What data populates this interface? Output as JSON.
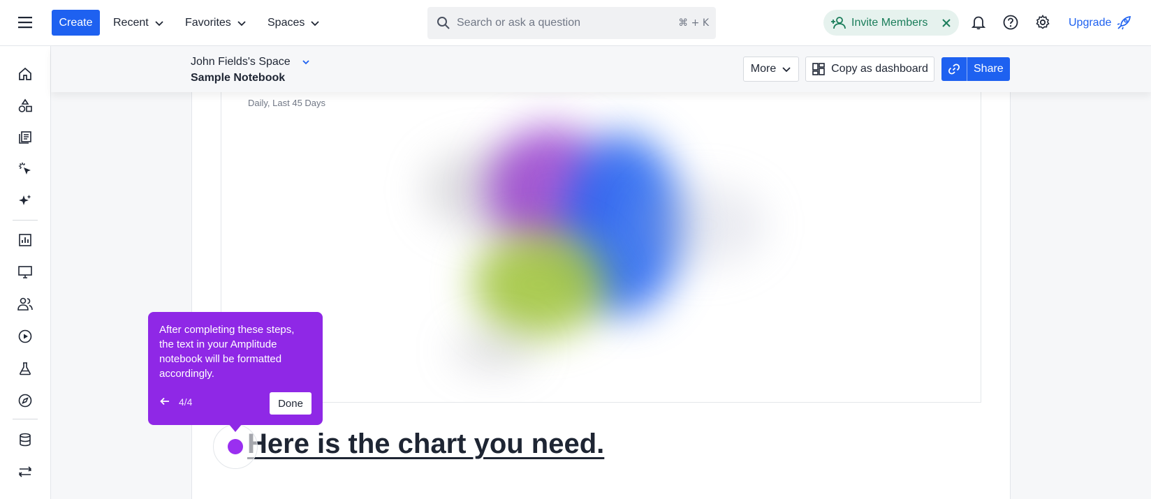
{
  "topbar": {
    "create_label": "Create",
    "nav": [
      {
        "label": "Recent"
      },
      {
        "label": "Favorites"
      },
      {
        "label": "Spaces"
      }
    ],
    "search": {
      "placeholder": "Search or ask a question",
      "shortcut": "⌘ + K"
    },
    "invite_label": "Invite Members",
    "upgrade_label": "Upgrade"
  },
  "sidebar": {
    "items": [
      {
        "icon": "home-icon"
      },
      {
        "icon": "shapes-icon"
      },
      {
        "icon": "content-icon"
      },
      {
        "icon": "click-icon"
      },
      {
        "icon": "sparkle-icon"
      },
      {
        "icon": "chart-icon"
      },
      {
        "icon": "monitor-icon"
      },
      {
        "icon": "users-icon"
      },
      {
        "icon": "replay-icon"
      },
      {
        "icon": "flask-icon"
      },
      {
        "icon": "compass-icon"
      },
      {
        "icon": "database-icon"
      },
      {
        "icon": "pipeline-icon"
      }
    ]
  },
  "header": {
    "space_name": "John Fields's Space",
    "notebook_title": "Sample Notebook",
    "more_label": "More",
    "copy_label": "Copy as dashboard",
    "share_label": "Share"
  },
  "chart": {
    "subtitle": "Daily, Last 45 Days"
  },
  "content": {
    "heading": "Here is the chart you need."
  },
  "tooltip": {
    "body": "After completing these steps, the text in your Amplitude notebook will be formatted accordingly.",
    "step": "4/4",
    "done_label": "Done"
  },
  "colors": {
    "primary": "#1e61f0",
    "tooltip": "#8f28e6",
    "invite_bg": "#e6f2ee",
    "invite_text": "#1a7d5a"
  }
}
